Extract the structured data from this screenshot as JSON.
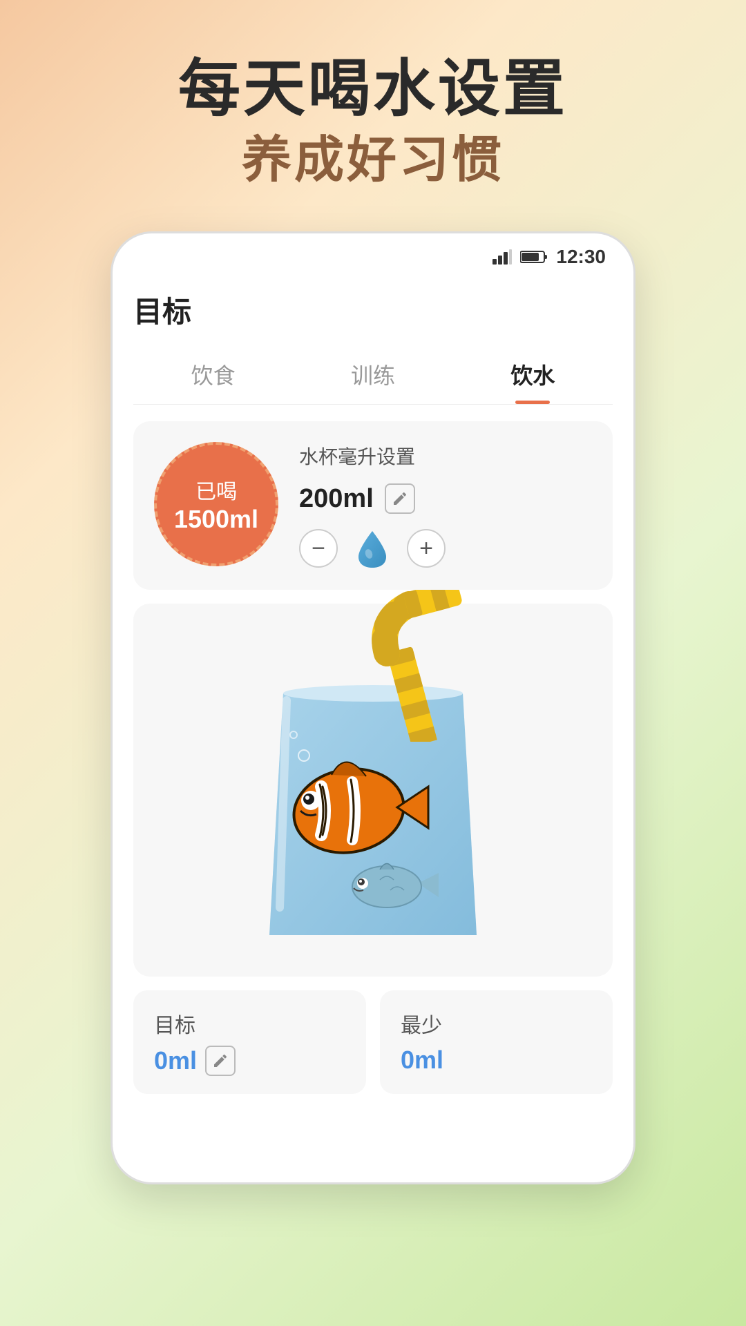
{
  "header": {
    "title_main": "每天喝水设置",
    "title_sub": "养成好习惯"
  },
  "status_bar": {
    "time": "12:30"
  },
  "page": {
    "title": "目标",
    "tabs": [
      {
        "label": "饮食",
        "active": false
      },
      {
        "label": "训练",
        "active": false
      },
      {
        "label": "饮水",
        "active": true
      }
    ],
    "drunk_circle": {
      "label": "已喝",
      "amount": "1500ml"
    },
    "cup_setting": {
      "section_label": "水杯毫升设置",
      "value": "200ml",
      "minus_label": "−",
      "plus_label": "+"
    },
    "bottom": {
      "goal_label": "目标",
      "goal_value": "0ml",
      "min_label": "最少",
      "min_value": "0ml"
    }
  }
}
